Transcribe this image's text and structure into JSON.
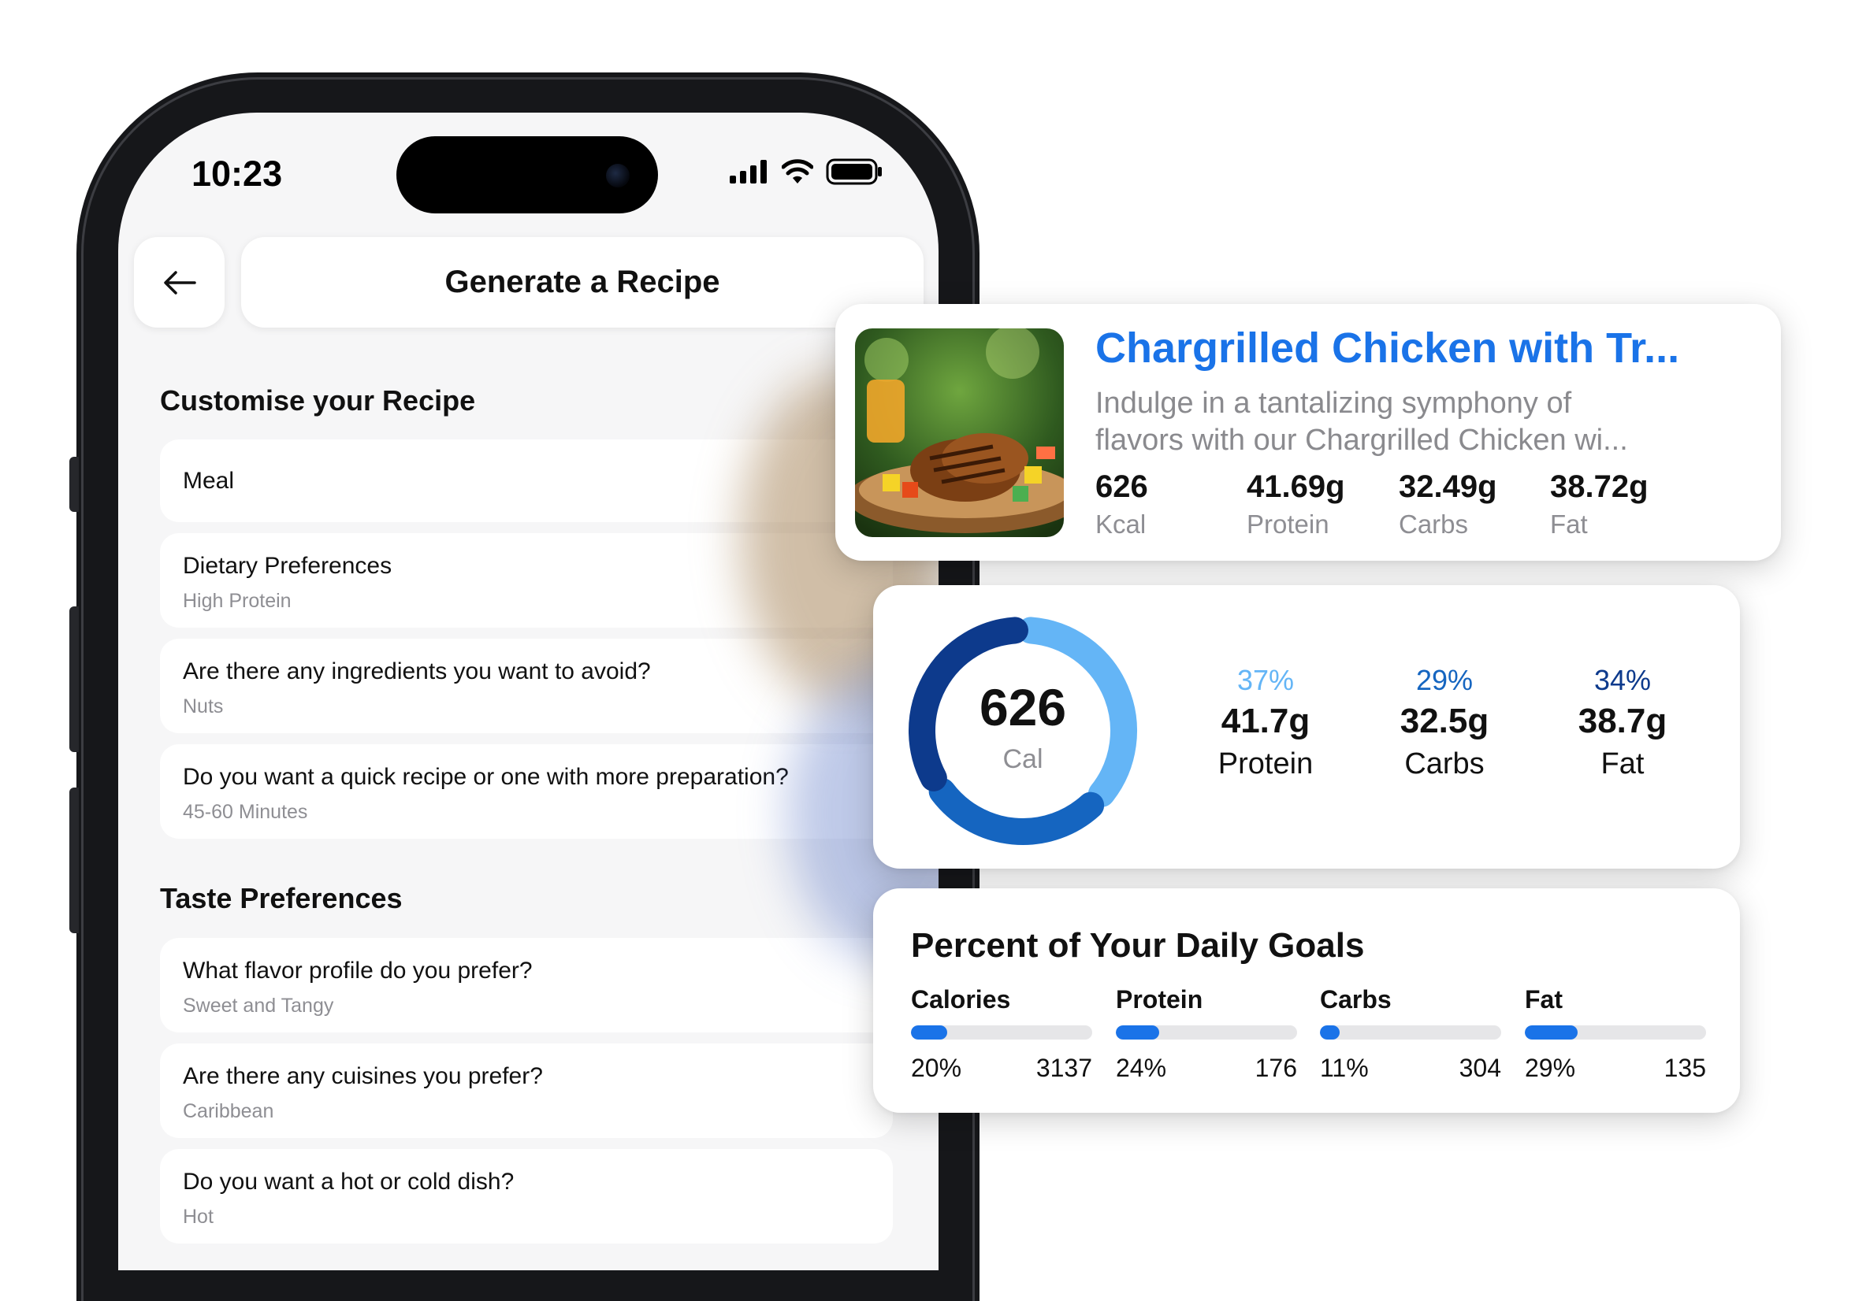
{
  "status_bar": {
    "time": "10:23"
  },
  "header": {
    "title": "Generate a Recipe"
  },
  "customise": {
    "title": "Customise your Recipe",
    "fields": [
      {
        "label": "Meal",
        "value": ""
      },
      {
        "label": "Dietary Preferences",
        "value": "High Protein"
      },
      {
        "label": "Are there any ingredients you want to avoid?",
        "value": "Nuts"
      },
      {
        "label": "Do you want a quick recipe or one with more preparation?",
        "value": "45-60 Minutes"
      }
    ]
  },
  "taste": {
    "title": "Taste Preferences",
    "fields": [
      {
        "label": "What flavor profile do you prefer?",
        "value": "Sweet and Tangy"
      },
      {
        "label": "Are there any cuisines you prefer?",
        "value": "Caribbean"
      },
      {
        "label": "Do you want a hot or cold dish?",
        "value": "Hot"
      }
    ]
  },
  "recipe_card": {
    "title": "Chargrilled Chicken with Tr...",
    "description_lines": [
      "Indulge in a tantalizing symphony of",
      "flavors with our Chargrilled Chicken wi..."
    ],
    "macros": [
      {
        "value": "626",
        "unit": "Kcal"
      },
      {
        "value": "41.69g",
        "unit": "Protein"
      },
      {
        "value": "32.49g",
        "unit": "Carbs"
      },
      {
        "value": "38.72g",
        "unit": "Fat"
      }
    ]
  },
  "nutrition_card": {
    "calories": "626",
    "calories_unit": "Cal",
    "splits": [
      {
        "percent": "37%",
        "grams": "41.7g",
        "name": "Protein",
        "color": "#64b5f6",
        "fraction": 0.37
      },
      {
        "percent": "29%",
        "grams": "32.5g",
        "name": "Carbs",
        "color": "#1565c0",
        "fraction": 0.29
      },
      {
        "percent": "34%",
        "grams": "38.7g",
        "name": "Fat",
        "color": "#0d3a8c",
        "fraction": 0.34
      }
    ]
  },
  "goals_card": {
    "title": "Percent of Your Daily Goals",
    "goals": [
      {
        "name": "Calories",
        "percent": "20%",
        "target": "3137",
        "fraction": 0.2
      },
      {
        "name": "Protein",
        "percent": "24%",
        "target": "176",
        "fraction": 0.24
      },
      {
        "name": "Carbs",
        "percent": "11%",
        "target": "304",
        "fraction": 0.11
      },
      {
        "name": "Fat",
        "percent": "29%",
        "target": "135",
        "fraction": 0.29
      }
    ]
  },
  "colors": {
    "accent": "#1a73e8",
    "muted": "#8e8e93",
    "screen_bg": "#f6f6f7"
  },
  "icons": {
    "back": "arrow-left-icon",
    "signal": "cellular-signal-icon",
    "wifi": "wifi-icon",
    "battery": "battery-icon"
  }
}
